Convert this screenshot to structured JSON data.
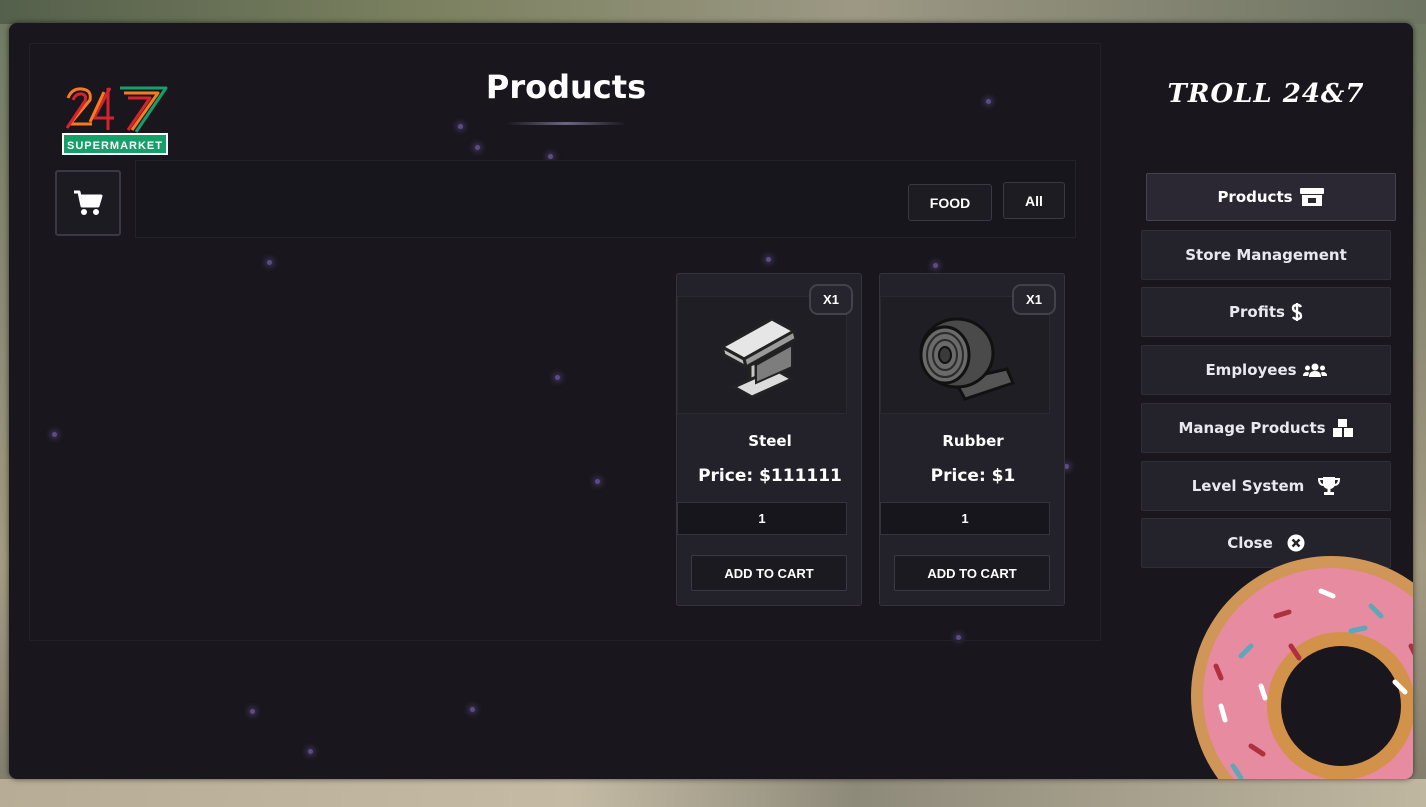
{
  "header": {
    "title": "Products",
    "store_name": "TROLL 24&7"
  },
  "logo": {
    "number": "247",
    "caption": "SUPERMARKET"
  },
  "filters": {
    "food_label": "FOOD",
    "all_label": "All"
  },
  "products": [
    {
      "name": "Steel",
      "price": "Price: $111111",
      "badge": "X1",
      "quantity": "1",
      "add_label": "ADD TO CART",
      "icon": "steel-beam-icon"
    },
    {
      "name": "Rubber",
      "price": "Price: $1",
      "badge": "X1",
      "quantity": "1",
      "add_label": "ADD TO CART",
      "icon": "rubber-roll-icon"
    }
  ],
  "nav": {
    "products": "Products",
    "store_management": "Store Management",
    "profits": "Profits",
    "employees": "Employees",
    "manage_products": "Manage Products",
    "level_system": "Level System",
    "close": "Close"
  },
  "colors": {
    "panel_bg": "#19171d",
    "card_bg": "#23212a",
    "accent_green": "#15a06a",
    "accent_orange": "#f47b20",
    "accent_red": "#d6232f"
  }
}
